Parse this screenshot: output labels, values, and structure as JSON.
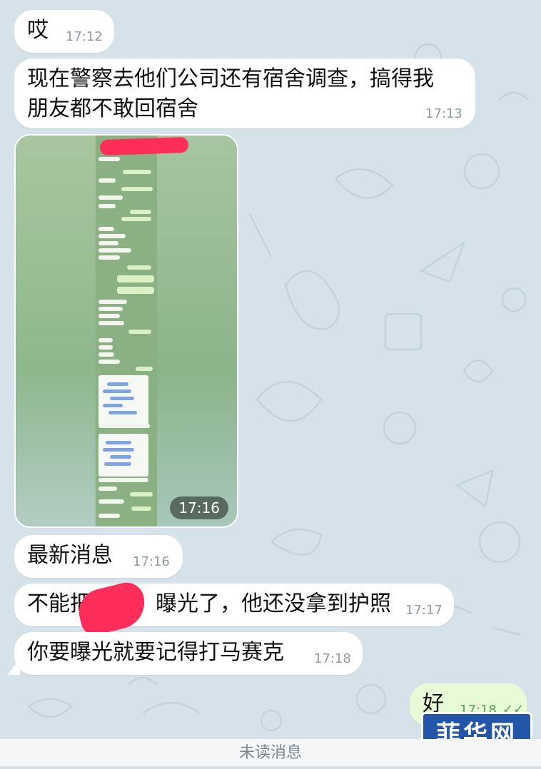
{
  "messages": [
    {
      "text": "哎",
      "time": "17:12"
    },
    {
      "text_line1": "现在警察去他们公司还有宿舍调查，搞得我",
      "text_line2": "朋友都不敢回宿舍",
      "time": "17:13"
    },
    {
      "media_duration": "17:16"
    },
    {
      "text": "最新消息",
      "time": "17:16"
    },
    {
      "text_before": "不能把",
      "text_after": "曝光了，他还没拿到护照",
      "time": "17:17"
    },
    {
      "text": "你要曝光就要记得打马赛克",
      "time": "17:18"
    },
    {
      "text": "好",
      "time": "17:18",
      "outgoing": true,
      "status": "✓✓"
    }
  ],
  "watermark": "菲华网",
  "unread_label": "未读消息",
  "colors": {
    "wallpaper": "#d5e2ea",
    "incoming_bubble": "#ffffff",
    "outgoing_bubble": "#e7fbd6",
    "redaction": "#ff2d5a",
    "watermark_bg": "#2355a8"
  }
}
